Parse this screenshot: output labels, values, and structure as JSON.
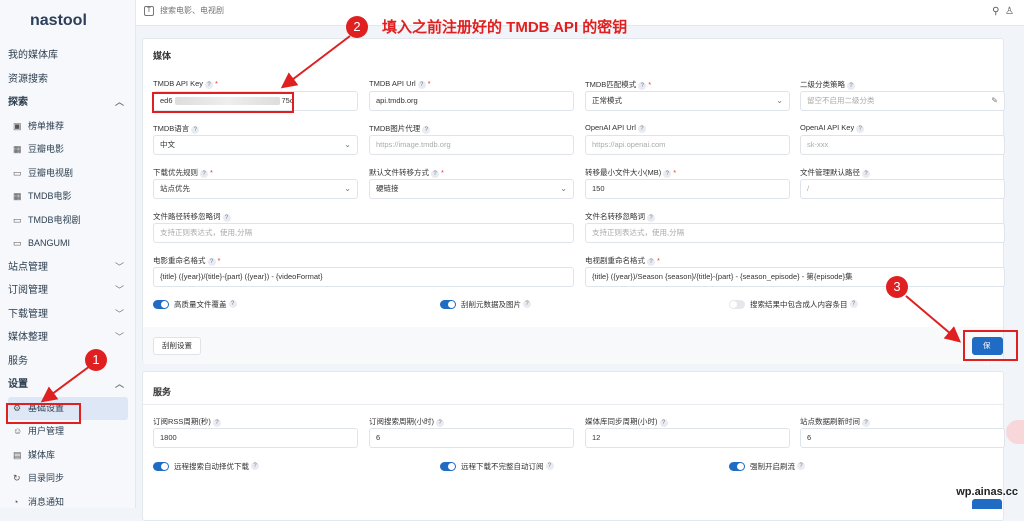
{
  "app": {
    "logo": "nastool"
  },
  "sidebar": {
    "items": [
      {
        "label": "我的媒体库"
      },
      {
        "label": "资源搜索"
      },
      {
        "label": "探索"
      },
      {
        "label": "榜单推荐"
      },
      {
        "label": "豆瓣电影"
      },
      {
        "label": "豆瓣电视剧"
      },
      {
        "label": "TMDB电影"
      },
      {
        "label": "TMDB电视剧"
      },
      {
        "label": "BANGUMI"
      },
      {
        "label": "站点管理"
      },
      {
        "label": "订阅管理"
      },
      {
        "label": "下载管理"
      },
      {
        "label": "媒体整理"
      },
      {
        "label": "服务"
      },
      {
        "label": "设置"
      },
      {
        "label": "基础设置"
      },
      {
        "label": "用户管理"
      },
      {
        "label": "媒体库"
      },
      {
        "label": "目录同步"
      },
      {
        "label": "消息通知"
      }
    ]
  },
  "topbar": {
    "search_placeholder": "搜索电影、电视剧"
  },
  "media": {
    "title": "媒体",
    "tmdb_key": {
      "label": "TMDB API Key",
      "value_start": "ed6",
      "value_end": "75c"
    },
    "tmdb_url": {
      "label": "TMDB API Url",
      "value": "api.tmdb.org"
    },
    "tmdb_match": {
      "label": "TMDB匹配模式",
      "value": "正常模式"
    },
    "category": {
      "label": "二级分类策略",
      "placeholder": "留空不启用二级分类"
    },
    "tmdb_lang": {
      "label": "TMDB语言",
      "value": "中文"
    },
    "tmdb_proxy": {
      "label": "TMDB图片代理",
      "placeholder": "https://image.tmdb.org"
    },
    "openai_url": {
      "label": "OpenAI API Url",
      "placeholder": "https://api.openai.com"
    },
    "openai_key": {
      "label": "OpenAI API Key",
      "placeholder": "sk-xxx"
    },
    "download_rule": {
      "label": "下载优先规则",
      "value": "站点优先"
    },
    "transfer_mode": {
      "label": "默认文件转移方式",
      "value": "硬链接"
    },
    "min_size": {
      "label": "转移最小文件大小(MB)",
      "value": "150"
    },
    "file_path": {
      "label": "文件管理默认路径",
      "placeholder": "/"
    },
    "path_ignore": {
      "label": "文件路径转移忽略词",
      "placeholder": "支持正则表达式，使用,分隔"
    },
    "name_ignore": {
      "label": "文件名转移忽略词",
      "placeholder": "支持正则表达式，使用,分隔"
    },
    "movie_format": {
      "label": "电影重命名格式",
      "value": "{title} ({year})/{title}-{part} ({year}) - {videoFormat}"
    },
    "tv_format": {
      "label": "电视剧重命名格式",
      "value": "{title} ({year})/Season {season}/{title}-{part} - {season_episode} - 第{episode}集"
    },
    "toggle_hq": "高质量文件覆盖",
    "toggle_scrape": "刮削元数据及图片",
    "toggle_adult": "搜索结果中包含成人内容条目",
    "scrape_btn": "刮削设置",
    "save_btn": "保存"
  },
  "service": {
    "title": "服务",
    "rss": {
      "label": "订阅RSS周期(秒)",
      "value": "1800"
    },
    "search": {
      "label": "订阅搜索周期(小时)",
      "value": "6"
    },
    "sync": {
      "label": "媒体库同步周期(小时)",
      "value": "12"
    },
    "refresh": {
      "label": "站点数据刷新时间",
      "value": "6"
    },
    "toggle_remote_best": "远程搜索自动择优下载",
    "toggle_remote_incomplete": "远程下载不完整自动订阅",
    "toggle_stream": "强制开启刷流"
  },
  "annotations": {
    "n1": "1",
    "n2": "2",
    "n3": "3",
    "text2": "填入之前注册好的 TMDB API 的密钥"
  },
  "watermark": "wp.ainas.cc",
  "colors": {
    "accent": "#206bc4",
    "annotation": "#e02020"
  }
}
